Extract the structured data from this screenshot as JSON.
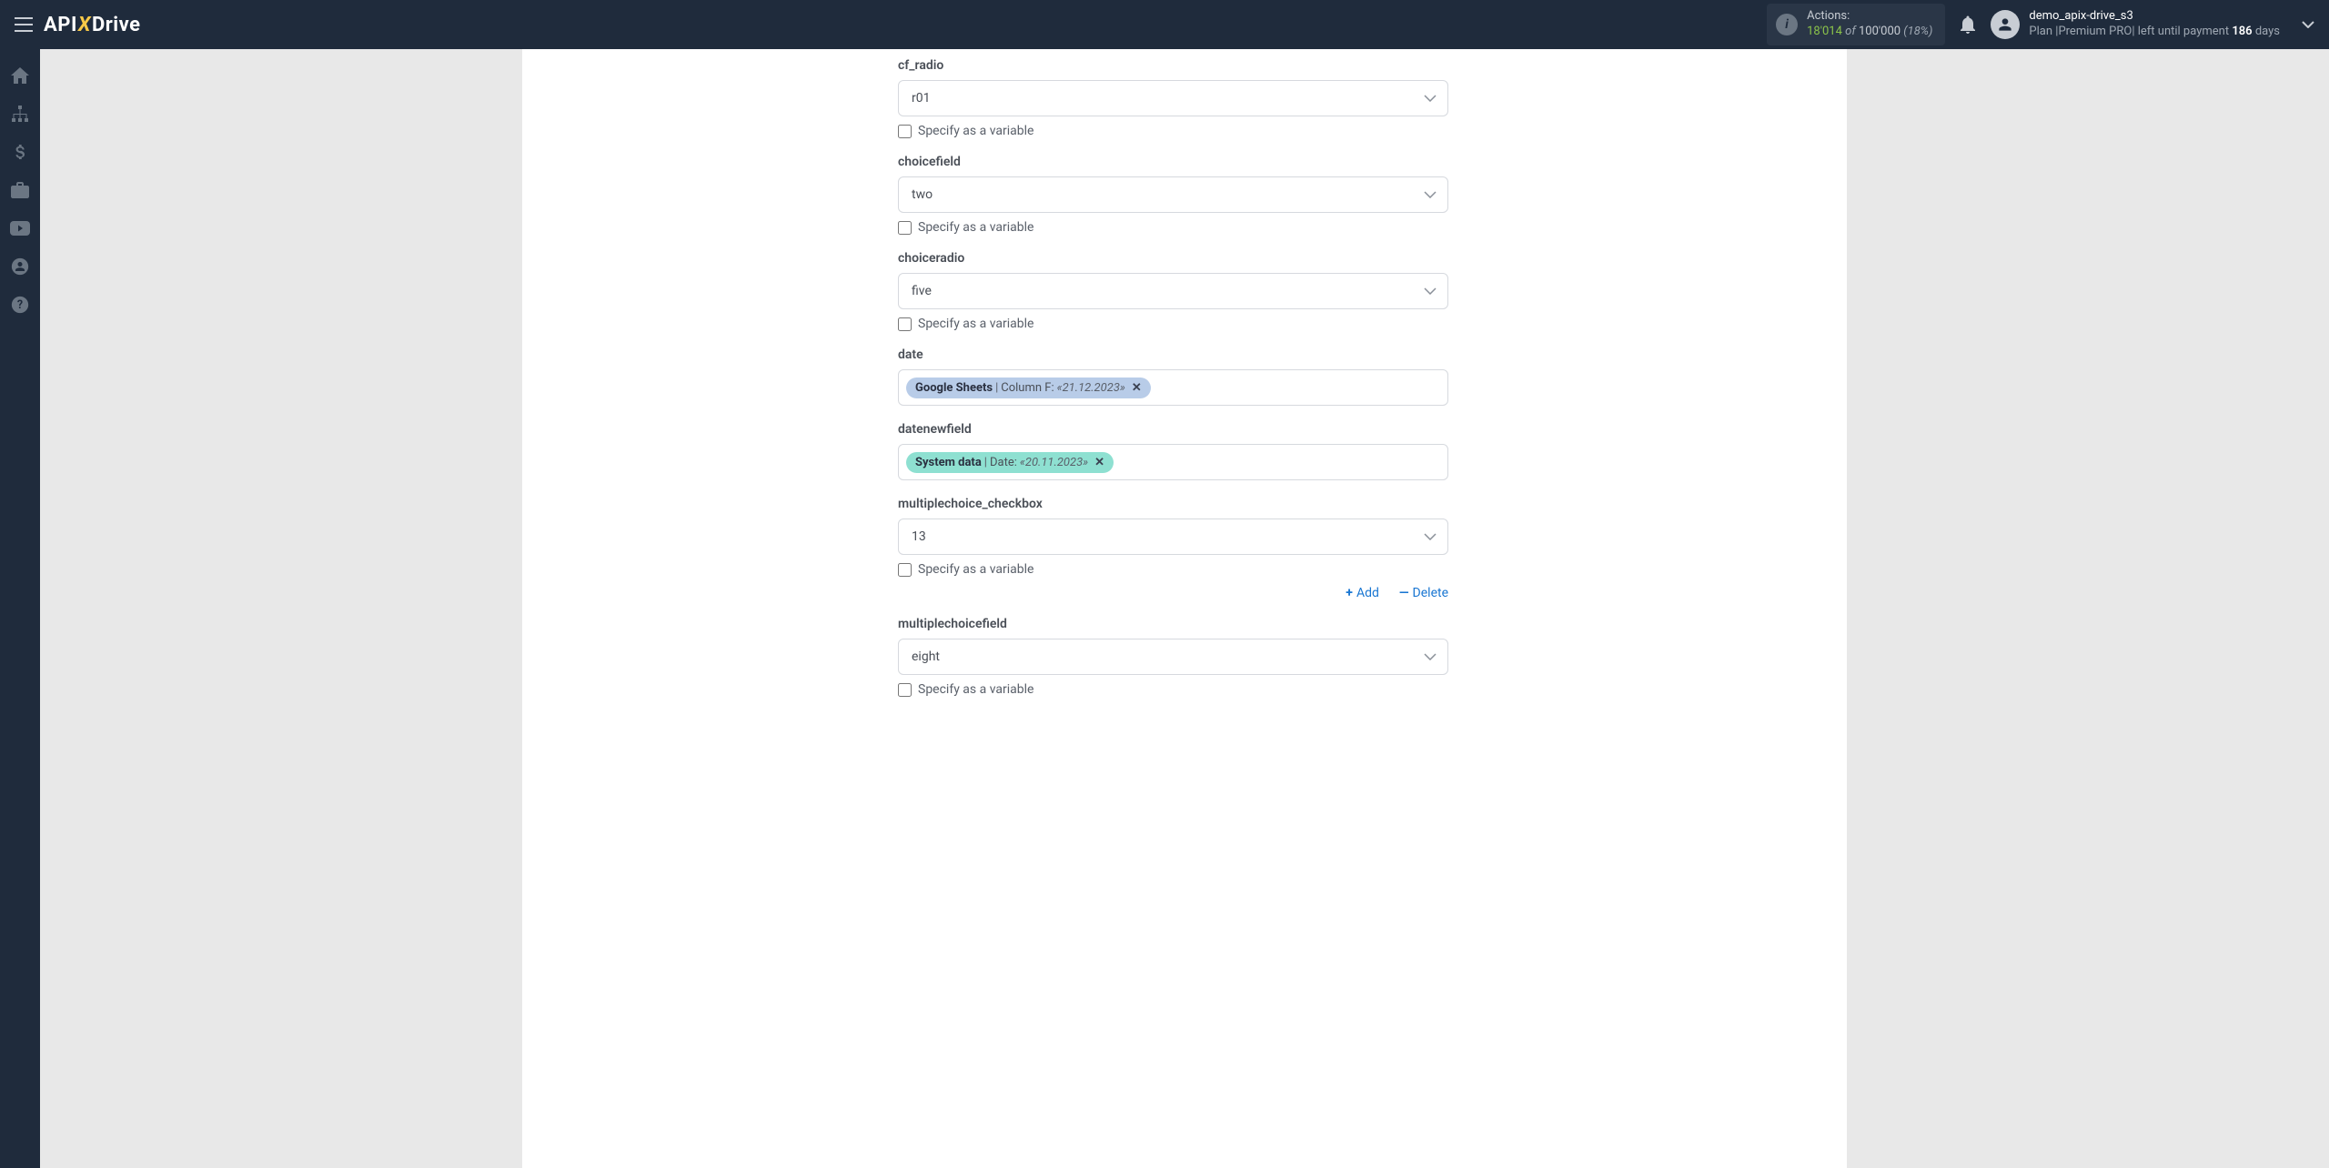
{
  "header": {
    "logo": {
      "part1": "API",
      "part2": "X",
      "part3": "Drive"
    },
    "actions": {
      "label": "Actions:",
      "used": "18'014",
      "of": "of",
      "total": "100'000",
      "pct": "(18%)"
    },
    "user": {
      "name": "demo_apix-drive_s3",
      "plan_prefix": "Plan |",
      "plan_name": "Premium PRO",
      "plan_mid": "| left until payment",
      "days_num": "186",
      "days_label": "days"
    }
  },
  "fields": {
    "cf_radio": {
      "label": "cf_radio",
      "value": "r01",
      "checkbox": "Specify as a variable"
    },
    "choicefield": {
      "label": "choicefield",
      "value": "two",
      "checkbox": "Specify as a variable"
    },
    "choiceradio": {
      "label": "choiceradio",
      "value": "five",
      "checkbox": "Specify as a variable"
    },
    "date": {
      "label": "date",
      "tag_src": "Google Sheets",
      "tag_pipe": " | ",
      "tag_col": "Column F: ",
      "tag_val": "«21.12.2023»"
    },
    "datenewfield": {
      "label": "datenewfield",
      "tag_src": "System data",
      "tag_pipe": " | ",
      "tag_col": "Date: ",
      "tag_val": "«20.11.2023»"
    },
    "multiplechoice_checkbox": {
      "label": "multiplechoice_checkbox",
      "value": "13",
      "checkbox": "Specify as a variable"
    },
    "multiplechoicefield": {
      "label": "multiplechoicefield",
      "value": "eight",
      "checkbox": "Specify as a variable"
    }
  },
  "actions": {
    "add": "Add",
    "delete": "Delete"
  }
}
